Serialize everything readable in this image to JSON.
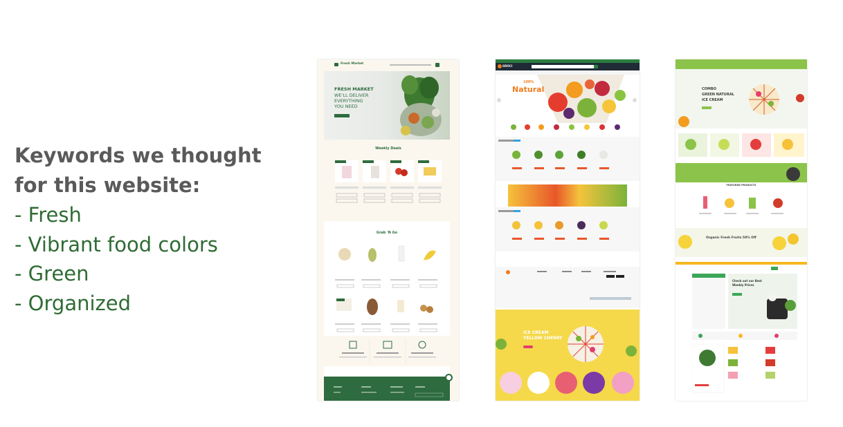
{
  "heading_lines": [
    "Keywords we thought",
    "for this website:"
  ],
  "keywords": [
    "- Fresh",
    "- Vibrant food colors",
    "- Green",
    "- Organized"
  ],
  "colors": {
    "heading": "#5a5a5a",
    "keyword": "#2f6b34",
    "brand_green": "#2e6b3e"
  },
  "screenshot1": {
    "brand": "Fresh Market",
    "hero_lines": [
      "FRESH MARKET",
      "WE'LL DELIVER",
      "EVERYTHING",
      "YOU NEED"
    ],
    "section1_title": "Weekly Deals",
    "section2_title": "Grab 'N Go"
  },
  "screenshot2": {
    "brand": "GROCI",
    "hero_word": "Natural",
    "hero_pct": "100%",
    "banner_lines": [
      "ICE CREAM",
      "YELLOW CHERRY"
    ]
  },
  "screenshot3": {
    "hero_lines": [
      "COMBO",
      "GREEN NATURAL",
      "ICE CREAM"
    ],
    "section_label": "FEATURED PRODUCTS",
    "promo": "Organic Fresh Fruits 50% Off",
    "store2_title_lines": [
      "Check out our Best",
      "Weekly Prices"
    ]
  }
}
